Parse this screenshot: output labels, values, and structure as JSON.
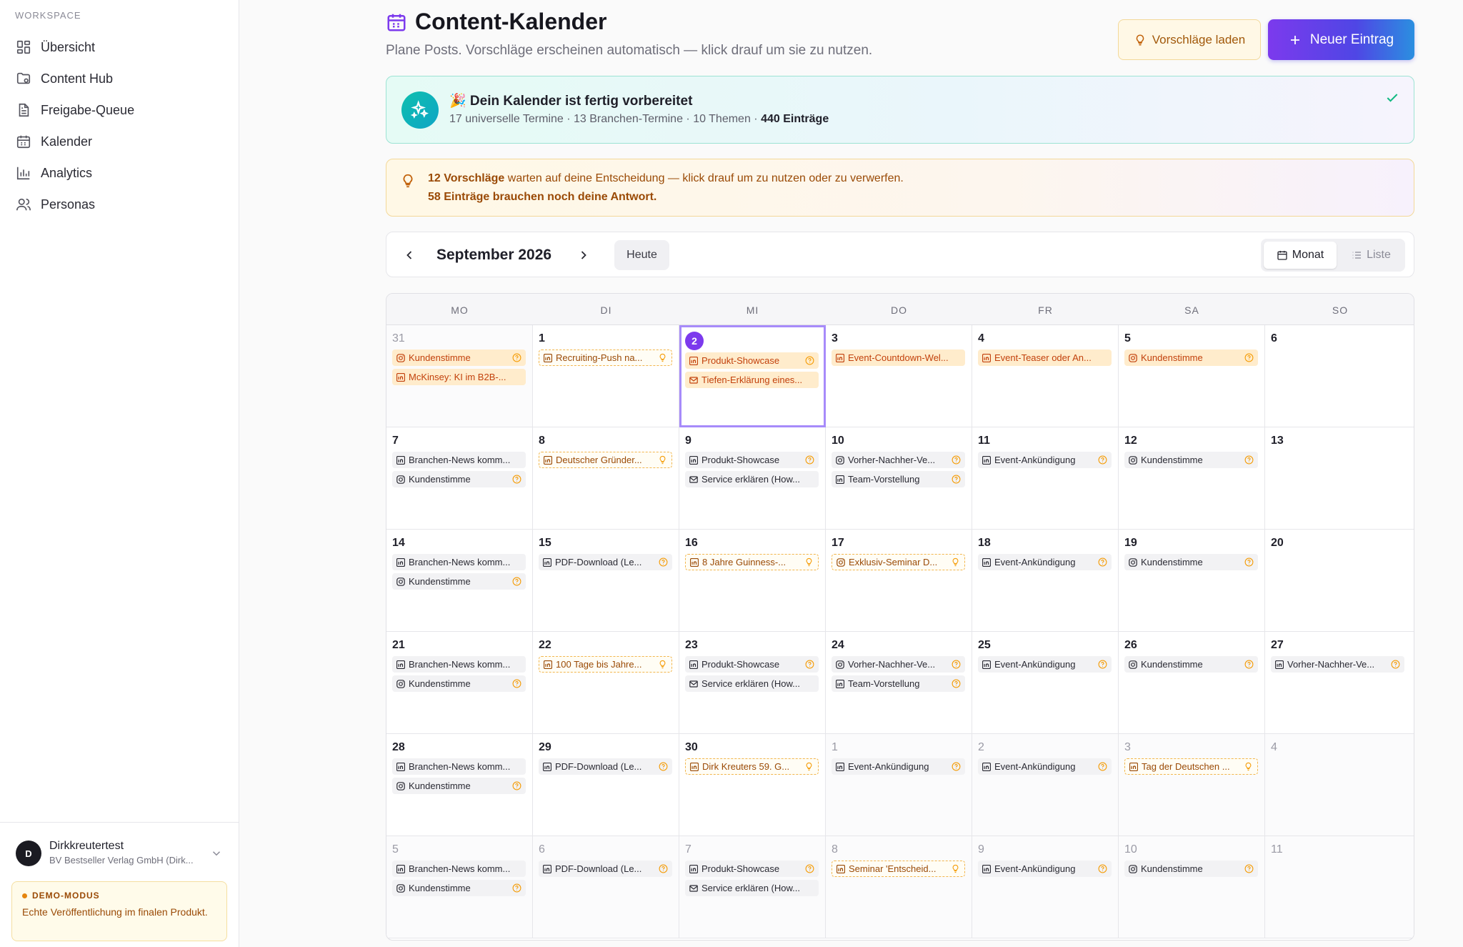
{
  "sidebar": {
    "section": "WORKSPACE",
    "items": [
      {
        "label": "Übersicht",
        "icon": "grid-icon"
      },
      {
        "label": "Content Hub",
        "icon": "folder-icon"
      },
      {
        "label": "Freigabe-Queue",
        "icon": "document-icon"
      },
      {
        "label": "Kalender",
        "icon": "calendar-icon"
      },
      {
        "label": "Analytics",
        "icon": "bar-chart-icon"
      },
      {
        "label": "Personas",
        "icon": "users-icon"
      }
    ],
    "user": {
      "initial": "D",
      "name": "Dirkkreutertest",
      "org": "BV Bestseller Verlag GmbH (Dirk..."
    },
    "demo": {
      "tag": "DEMO-MODUS",
      "text": "Echte Veröffentlichung im finalen Produkt."
    }
  },
  "header": {
    "title": "Content-Kalender",
    "subtitle": "Plane Posts. Vorschläge erscheinen automatisch — klick drauf um sie zu nutzen.",
    "suggest_button": "Vorschläge laden",
    "new_button": "Neuer Eintrag"
  },
  "ready": {
    "title": "🎉 Dein Kalender ist fertig vorbereitet",
    "sub": "17 universelle Termine · 13 Branchen-Termine · 10 Themen · ",
    "sub_bold": "440 Einträge"
  },
  "suggestions": {
    "line1_bold": "12 Vorschläge",
    "line1": " warten auf deine Entscheidung — klick drauf um zu nutzen oder zu verwerfen.",
    "line2": "58 Einträge brauchen noch deine Antwort."
  },
  "toolbar": {
    "month": "September 2026",
    "today": "Heute",
    "view_month": "Monat",
    "view_list": "Liste"
  },
  "colors": {
    "accent": "#7c3aed",
    "orange": "#c2410c",
    "teal": "#0fbfae"
  },
  "calendar": {
    "weekdays": [
      "MO",
      "DI",
      "MI",
      "DO",
      "FR",
      "SA",
      "SO"
    ],
    "weeks": [
      [
        {
          "day": "31",
          "other": true,
          "events": [
            {
              "t": "Kundenstimme",
              "i": "instagram",
              "s": "orange"
            },
            {
              "t": "McKinsey: KI im B2B-...",
              "i": "linkedin",
              "s": "orange",
              "n": true
            }
          ]
        },
        {
          "day": "1",
          "events": [
            {
              "t": "Recruiting-Push na...",
              "i": "linkedin",
              "s": "dashed"
            }
          ]
        },
        {
          "day": "2",
          "today": true,
          "events": [
            {
              "t": "Produkt-Showcase",
              "i": "linkedin",
              "s": "orange"
            },
            {
              "t": "Tiefen-Erklärung eines...",
              "i": "mail",
              "s": "orange",
              "n": true
            }
          ]
        },
        {
          "day": "3",
          "events": [
            {
              "t": "Event-Countdown-Wel...",
              "i": "linkedin",
              "s": "orange",
              "n": true
            }
          ]
        },
        {
          "day": "4",
          "events": [
            {
              "t": "Event-Teaser oder An...",
              "i": "linkedin",
              "s": "orange",
              "n": true
            }
          ]
        },
        {
          "day": "5",
          "events": [
            {
              "t": "Kundenstimme",
              "i": "instagram",
              "s": "orange"
            }
          ]
        },
        {
          "day": "6",
          "events": []
        }
      ],
      [
        {
          "day": "7",
          "events": [
            {
              "t": "Branchen-News komm...",
              "i": "linkedin",
              "s": "neutral",
              "n": true
            },
            {
              "t": "Kundenstimme",
              "i": "instagram",
              "s": "neutral"
            }
          ]
        },
        {
          "day": "8",
          "events": [
            {
              "t": "Deutscher Gründer...",
              "i": "linkedin",
              "s": "dashed"
            }
          ]
        },
        {
          "day": "9",
          "events": [
            {
              "t": "Produkt-Showcase",
              "i": "linkedin",
              "s": "neutral"
            },
            {
              "t": "Service erklären (How...",
              "i": "mail",
              "s": "neutral",
              "n": true
            }
          ]
        },
        {
          "day": "10",
          "events": [
            {
              "t": "Vorher-Nachher-Ve...",
              "i": "instagram",
              "s": "neutral"
            },
            {
              "t": "Team-Vorstellung",
              "i": "linkedin",
              "s": "neutral"
            }
          ]
        },
        {
          "day": "11",
          "events": [
            {
              "t": "Event-Ankündigung",
              "i": "linkedin",
              "s": "neutral"
            }
          ]
        },
        {
          "day": "12",
          "events": [
            {
              "t": "Kundenstimme",
              "i": "instagram",
              "s": "neutral"
            }
          ]
        },
        {
          "day": "13",
          "events": []
        }
      ],
      [
        {
          "day": "14",
          "events": [
            {
              "t": "Branchen-News komm...",
              "i": "linkedin",
              "s": "neutral",
              "n": true
            },
            {
              "t": "Kundenstimme",
              "i": "instagram",
              "s": "neutral"
            }
          ]
        },
        {
          "day": "15",
          "events": [
            {
              "t": "PDF-Download (Le...",
              "i": "linkedin",
              "s": "neutral"
            }
          ]
        },
        {
          "day": "16",
          "events": [
            {
              "t": "8 Jahre Guinness-...",
              "i": "linkedin",
              "s": "dashed"
            }
          ]
        },
        {
          "day": "17",
          "events": [
            {
              "t": "Exklusiv-Seminar D...",
              "i": "instagram",
              "s": "dashed"
            }
          ]
        },
        {
          "day": "18",
          "events": [
            {
              "t": "Event-Ankündigung",
              "i": "linkedin",
              "s": "neutral"
            }
          ]
        },
        {
          "day": "19",
          "events": [
            {
              "t": "Kundenstimme",
              "i": "instagram",
              "s": "neutral"
            }
          ]
        },
        {
          "day": "20",
          "events": []
        }
      ],
      [
        {
          "day": "21",
          "events": [
            {
              "t": "Branchen-News komm...",
              "i": "linkedin",
              "s": "neutral",
              "n": true
            },
            {
              "t": "Kundenstimme",
              "i": "instagram",
              "s": "neutral"
            }
          ]
        },
        {
          "day": "22",
          "events": [
            {
              "t": "100 Tage bis Jahre...",
              "i": "linkedin",
              "s": "dashed"
            }
          ]
        },
        {
          "day": "23",
          "events": [
            {
              "t": "Produkt-Showcase",
              "i": "linkedin",
              "s": "neutral"
            },
            {
              "t": "Service erklären (How...",
              "i": "mail",
              "s": "neutral",
              "n": true
            }
          ]
        },
        {
          "day": "24",
          "events": [
            {
              "t": "Vorher-Nachher-Ve...",
              "i": "instagram",
              "s": "neutral"
            },
            {
              "t": "Team-Vorstellung",
              "i": "linkedin",
              "s": "neutral"
            }
          ]
        },
        {
          "day": "25",
          "events": [
            {
              "t": "Event-Ankündigung",
              "i": "linkedin",
              "s": "neutral"
            }
          ]
        },
        {
          "day": "26",
          "events": [
            {
              "t": "Kundenstimme",
              "i": "instagram",
              "s": "neutral"
            }
          ]
        },
        {
          "day": "27",
          "events": [
            {
              "t": "Vorher-Nachher-Ve...",
              "i": "linkedin",
              "s": "neutral"
            }
          ]
        }
      ],
      [
        {
          "day": "28",
          "events": [
            {
              "t": "Branchen-News komm...",
              "i": "linkedin",
              "s": "neutral",
              "n": true
            },
            {
              "t": "Kundenstimme",
              "i": "instagram",
              "s": "neutral"
            }
          ]
        },
        {
          "day": "29",
          "events": [
            {
              "t": "PDF-Download (Le...",
              "i": "linkedin",
              "s": "neutral"
            }
          ]
        },
        {
          "day": "30",
          "events": [
            {
              "t": "Dirk Kreuters 59. G...",
              "i": "linkedin",
              "s": "dashed"
            }
          ]
        },
        {
          "day": "1",
          "other": true,
          "events": [
            {
              "t": "Event-Ankündigung",
              "i": "linkedin",
              "s": "neutral"
            }
          ]
        },
        {
          "day": "2",
          "other": true,
          "events": [
            {
              "t": "Event-Ankündigung",
              "i": "linkedin",
              "s": "neutral"
            }
          ]
        },
        {
          "day": "3",
          "other": true,
          "events": [
            {
              "t": "Tag der Deutschen ...",
              "i": "linkedin",
              "s": "dashed"
            }
          ]
        },
        {
          "day": "4",
          "other": true,
          "events": []
        }
      ],
      [
        {
          "day": "5",
          "other": true,
          "events": [
            {
              "t": "Branchen-News komm...",
              "i": "linkedin",
              "s": "neutral",
              "n": true
            },
            {
              "t": "Kundenstimme",
              "i": "instagram",
              "s": "neutral"
            }
          ]
        },
        {
          "day": "6",
          "other": true,
          "events": [
            {
              "t": "PDF-Download (Le...",
              "i": "linkedin",
              "s": "neutral"
            }
          ]
        },
        {
          "day": "7",
          "other": true,
          "events": [
            {
              "t": "Produkt-Showcase",
              "i": "linkedin",
              "s": "neutral"
            },
            {
              "t": "Service erklären (How...",
              "i": "mail",
              "s": "neutral",
              "n": true
            }
          ]
        },
        {
          "day": "8",
          "other": true,
          "events": [
            {
              "t": "Seminar 'Entscheid...",
              "i": "linkedin",
              "s": "dashed"
            }
          ]
        },
        {
          "day": "9",
          "other": true,
          "events": [
            {
              "t": "Event-Ankündigung",
              "i": "linkedin",
              "s": "neutral"
            }
          ]
        },
        {
          "day": "10",
          "other": true,
          "events": [
            {
              "t": "Kundenstimme",
              "i": "instagram",
              "s": "neutral"
            }
          ]
        },
        {
          "day": "11",
          "other": true,
          "events": []
        }
      ]
    ]
  }
}
